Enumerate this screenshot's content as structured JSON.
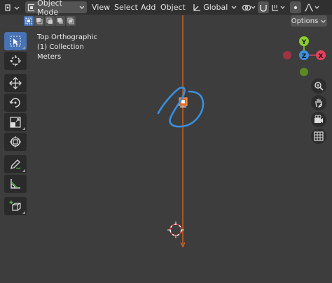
{
  "header": {
    "mode": "Object Mode",
    "menus": [
      "View",
      "Select",
      "Add",
      "Object"
    ],
    "transform_orientation": "Global"
  },
  "viewport_info": {
    "view_name": "Top Orthographic",
    "collection": "(1) Collection",
    "units": "Meters"
  },
  "options_label": "Options",
  "gizmo": {
    "axes": [
      {
        "label": "Y",
        "color": "#8bcf2e"
      },
      {
        "label": "X",
        "color": "#e5415b"
      },
      {
        "label": "Z",
        "color": "#3d8fe0"
      }
    ]
  },
  "colors": {
    "accent": "#4772b3",
    "origin_line": "#e4691e",
    "annotation": "#3a8fe0",
    "background": "#3d3d3d",
    "header": "#303030"
  },
  "toolbar_tools": [
    "select-box-icon",
    "cursor-icon",
    "move-icon",
    "rotate-icon",
    "scale-icon",
    "transform-icon",
    "annotate-icon",
    "measure-icon",
    "add-cube-icon"
  ],
  "nav_buttons": [
    "zoom-icon",
    "pan-hand-icon",
    "camera-icon",
    "grid-icon"
  ]
}
